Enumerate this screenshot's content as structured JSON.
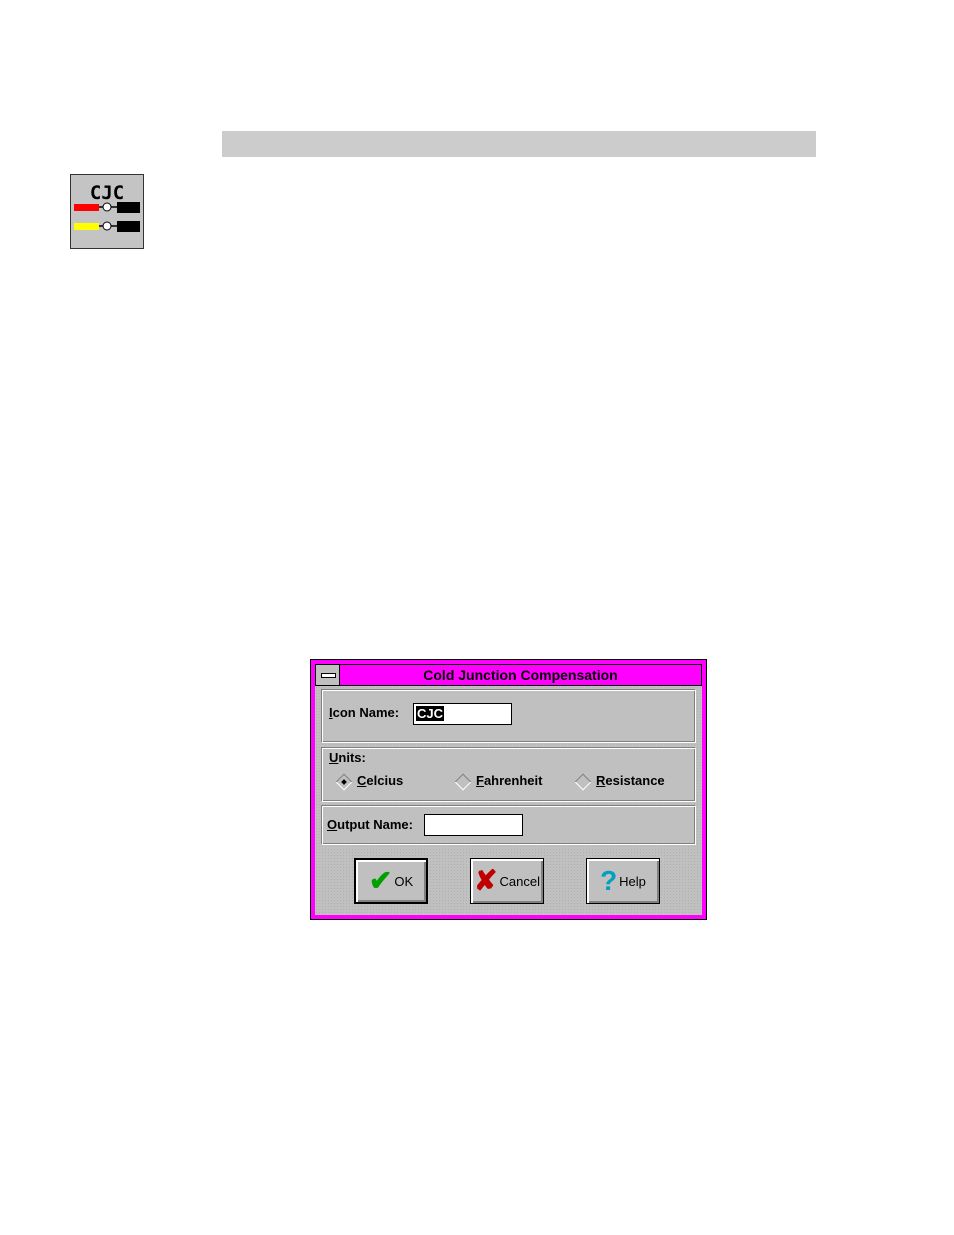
{
  "page": {
    "icon_title": "CJC"
  },
  "dialog": {
    "title": "Cold Junction Compensation",
    "icon_name": {
      "label_hotkey": "I",
      "label_rest": "con Name:",
      "value": "CJC"
    },
    "units": {
      "label_hotkey": "U",
      "label_rest": "nits:",
      "options": [
        {
          "hotkey": "C",
          "rest": "elcius",
          "selected": true
        },
        {
          "hotkey": "F",
          "rest": "ahrenheit",
          "selected": false
        },
        {
          "hotkey": "R",
          "rest": "esistance",
          "selected": false
        }
      ]
    },
    "output_name": {
      "label_hotkey": "O",
      "label_rest": "utput Name:",
      "value": ""
    },
    "buttons": {
      "ok": "OK",
      "cancel": "Cancel",
      "help": "Help"
    }
  },
  "colors": {
    "title_bar": "#ff00ff",
    "ok_check": "#00a000",
    "cancel_x": "#c00000",
    "help_q": "#00a0c0"
  }
}
